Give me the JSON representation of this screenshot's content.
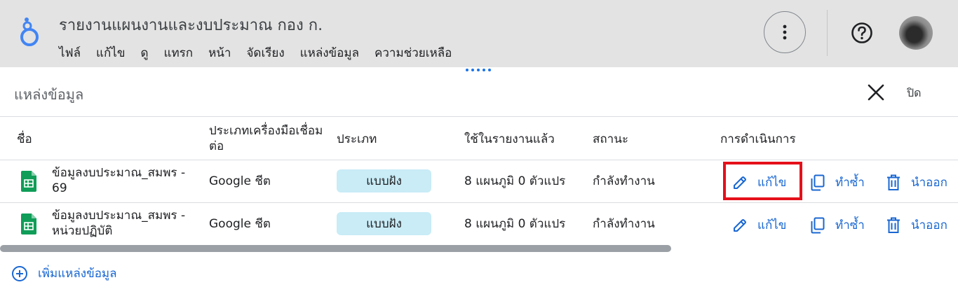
{
  "header": {
    "title": "รายงานแผนงานและงบประมาณ กอง ก.",
    "menu": [
      "ไฟล์",
      "แก้ไข",
      "ดู",
      "แทรก",
      "หน้า",
      "จัดเรียง",
      "แหล่งข้อมูล",
      "ความช่วยเหลือ"
    ]
  },
  "panel": {
    "title": "แหล่งข้อมูล",
    "close_label": "ปิด"
  },
  "table": {
    "columns": [
      "ชื่อ",
      "ประเภทเครื่องมือเชื่อมต่อ",
      "ประเภท",
      "ใช้ในรายงานแล้ว",
      "สถานะ",
      "การดำเนินการ"
    ],
    "rows": [
      {
        "name": "ข้อมูลงบประมาณ_สมพร - 69",
        "connector": "Google ชีต",
        "type": "แบบฝัง",
        "usage": "8 แผนภูมิ 0 ตัวแปร",
        "status": "กำลังทำงาน"
      },
      {
        "name": "ข้อมูลงบประมาณ_สมพร - หน่วยปฏิบัติ",
        "connector": "Google ชีต",
        "type": "แบบฝัง",
        "usage": "8 แผนภูมิ 0 ตัวแปร",
        "status": "กำลังทำงาน"
      }
    ],
    "actions": {
      "edit": "แก้ไข",
      "duplicate": "ทำซ้ำ",
      "remove": "นำออก"
    }
  },
  "add_source_label": "เพิ่มแหล่งข้อมูล",
  "colors": {
    "header_bg": "#e3e3e3",
    "accent_blue": "#1967d2",
    "badge_bg": "#c9ecf6",
    "highlight_red": "#e4101a",
    "sheets_green": "#0f9d58"
  },
  "icons": [
    "looker-studio-logo-icon",
    "more-vert-icon",
    "help-icon",
    "close-icon",
    "google-sheets-icon",
    "edit-pencil-icon",
    "copy-icon",
    "trash-icon",
    "add-circle-icon"
  ]
}
